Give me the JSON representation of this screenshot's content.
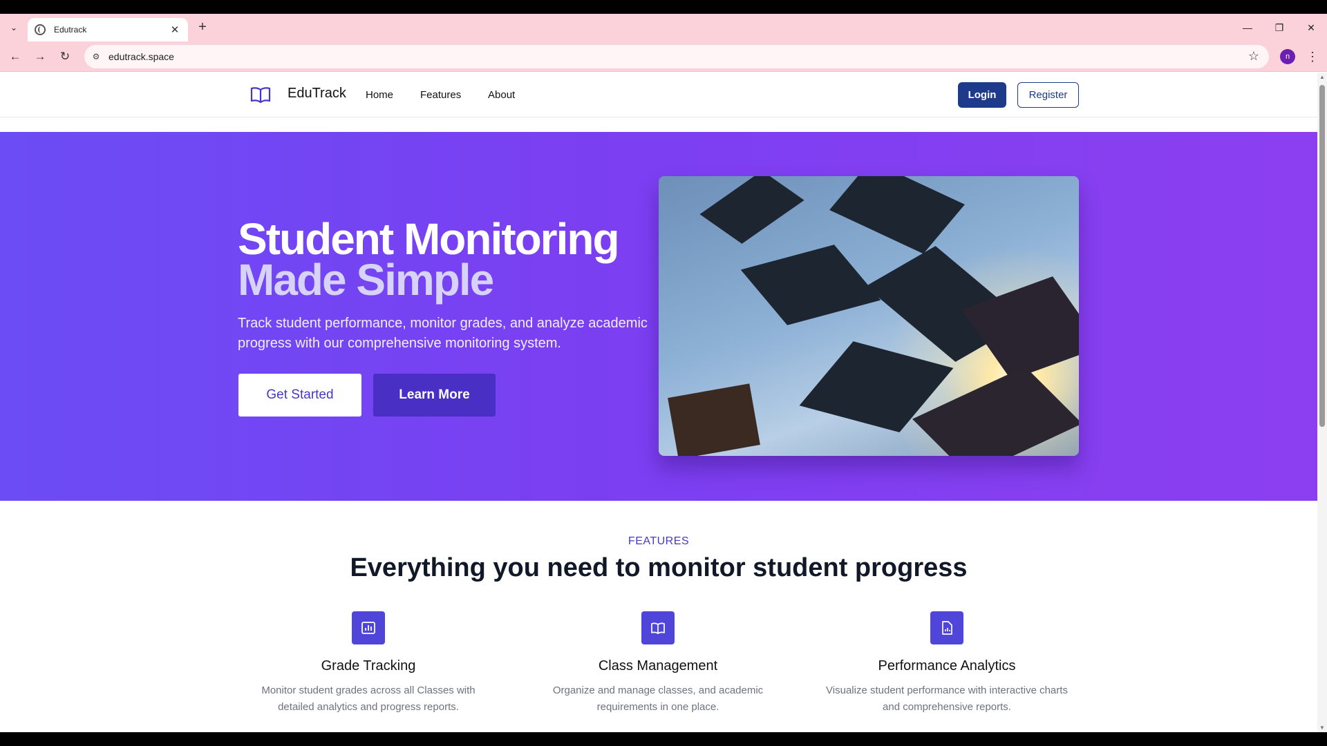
{
  "browser": {
    "tab_title": "Edutrack",
    "url": "edutrack.space",
    "profile_initial": "n",
    "icons": [
      "tab-list-icon",
      "globe-icon",
      "close-icon",
      "plus-icon",
      "minimize-icon",
      "restore-icon",
      "window-close-icon",
      "back-icon",
      "forward-icon",
      "reload-icon",
      "site-info-icon",
      "star-icon",
      "kebab-menu-icon"
    ]
  },
  "nav": {
    "brand": "EduTrack",
    "links": [
      "Home",
      "Features",
      "About"
    ],
    "login": "Login",
    "register": "Register"
  },
  "hero": {
    "title_line1": "Student Monitoring",
    "title_line2": "Made Simple",
    "description": "Track student performance, monitor grades, and analyze academic progress with our comprehensive monitoring system.",
    "cta_primary": "Get Started",
    "cta_secondary": "Learn More"
  },
  "features": {
    "kicker": "FEATURES",
    "title": "Everything you need to monitor student progress",
    "items": [
      {
        "name": "Grade Tracking",
        "description": "Monitor student grades across all Classes with detailed analytics and progress reports.",
        "icon": "bar-chart-icon"
      },
      {
        "name": "Class Management",
        "description": "Organize and manage classes, and academic requirements in one place.",
        "icon": "book-icon"
      },
      {
        "name": "Performance Analytics",
        "description": "Visualize student performance with interactive charts and comprehensive reports.",
        "icon": "document-chart-icon"
      }
    ]
  },
  "colors": {
    "hero_gradient_start": "#6b4cf5",
    "hero_gradient_end": "#8c3ff0",
    "primary_dark": "#1e3a8a",
    "accent": "#4338ca",
    "tab_strip": "#fbd2da"
  }
}
